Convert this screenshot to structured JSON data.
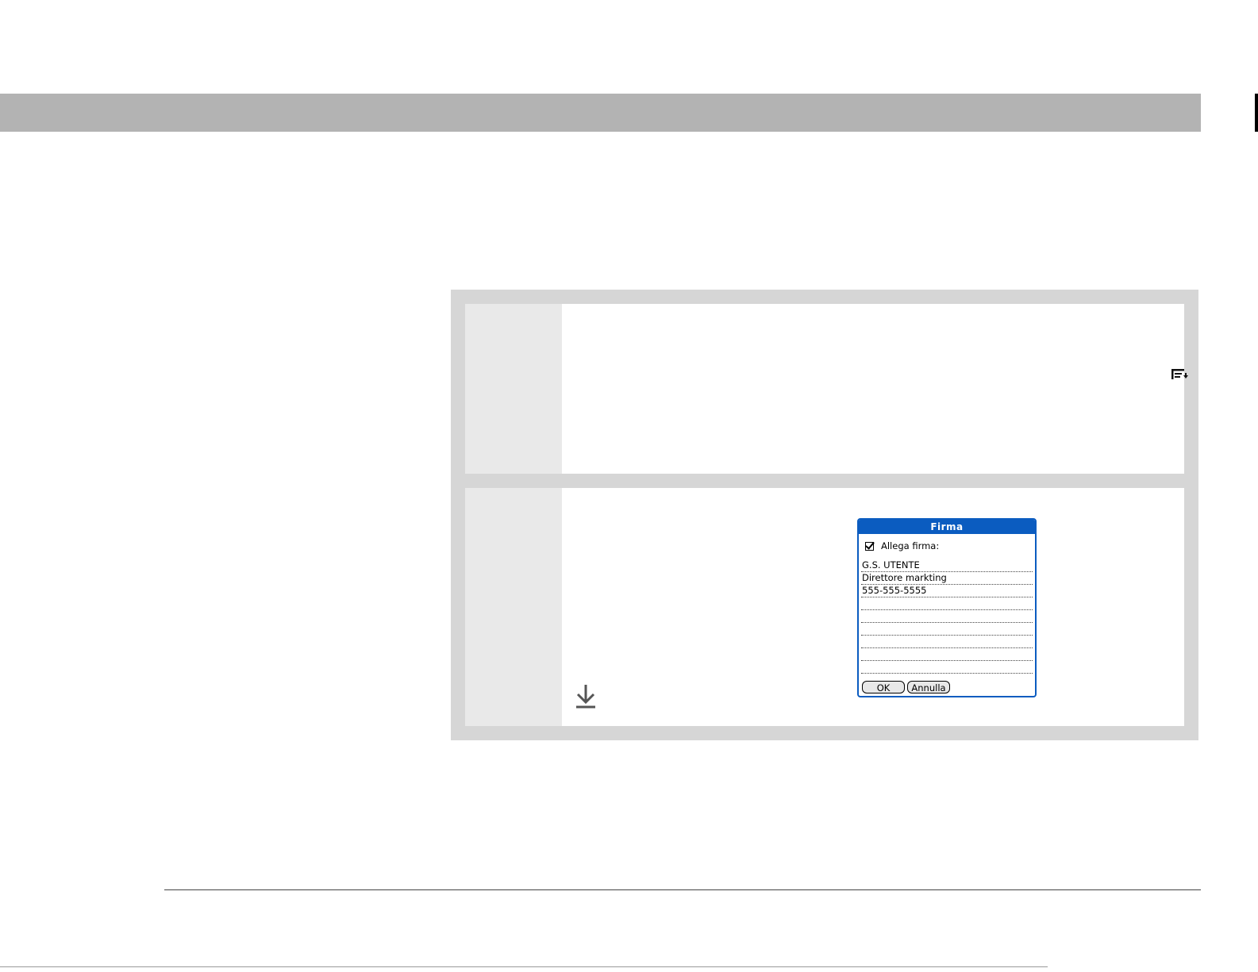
{
  "icons": {
    "menu_icon": "menu-icon",
    "scroll_down_icon": "down-arrow-icon",
    "checkbox_icon": "checkbox-checked-icon"
  },
  "colors": {
    "header_bar": "#b3b3b3",
    "panel": "#d6d6d6",
    "step_number_column": "#e9e9e9",
    "dialog_accent": "#0b5cc0"
  },
  "dialog": {
    "title": "Firma",
    "checkbox_label": "Allega firma:",
    "checkbox_checked": true,
    "signature_lines": [
      "G.S. UTENTE",
      "Direttore markting",
      "555-555-5555",
      "",
      "",
      "",
      "",
      "",
      ""
    ],
    "ok_label": "OK",
    "cancel_label": "Annulla"
  }
}
